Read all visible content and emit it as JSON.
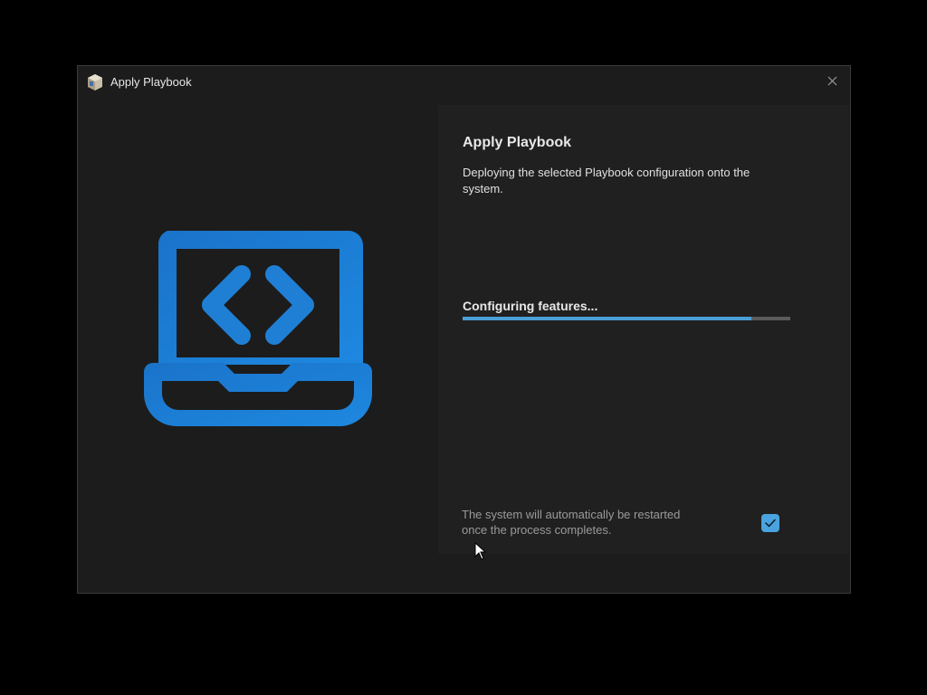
{
  "window": {
    "title": "Apply Playbook"
  },
  "main": {
    "heading": "Apply Playbook",
    "description": "Deploying the selected Playbook configuration onto the system.",
    "status": "Configuring features...",
    "progress_percent": 88,
    "restart_note": "The system will automatically be restarted once the process completes.",
    "restart_checked": true
  },
  "colors": {
    "accent": "#4a9fd8",
    "hero_icon": "#1f7fd4",
    "window_bg": "#1c1c1c",
    "pane_bg": "#202020"
  },
  "icons": {
    "app": "playbook-box-icon",
    "close": "close-icon",
    "hero": "laptop-code-icon",
    "check": "checkmark-icon",
    "cursor": "mouse-pointer-icon"
  }
}
